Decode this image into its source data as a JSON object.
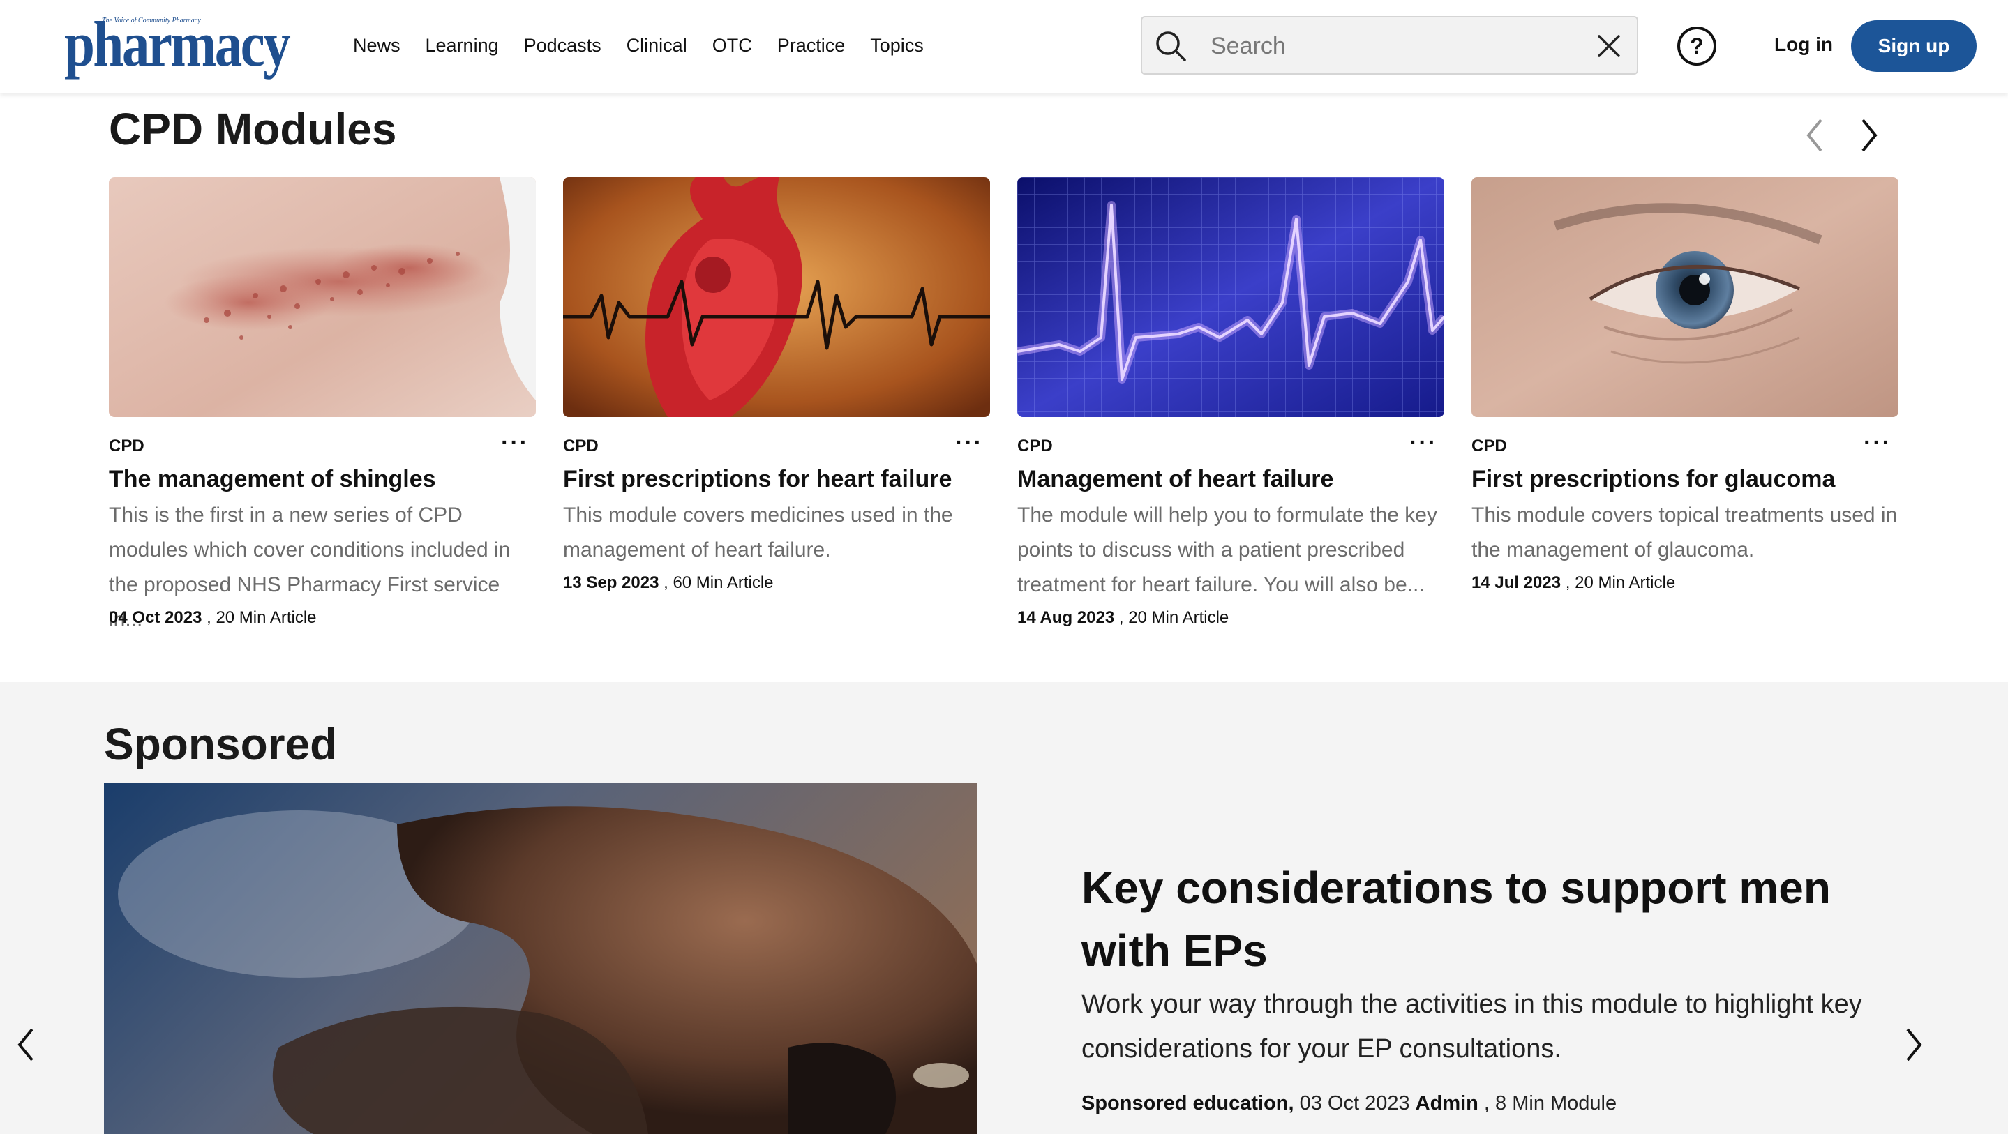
{
  "brand": {
    "logo_word": "pharmacy",
    "logo_tagline": "The Voice of Community Pharmacy",
    "color": "#1f4f8f"
  },
  "nav": [
    "News",
    "Learning",
    "Podcasts",
    "Clinical",
    "OTC",
    "Practice",
    "Topics"
  ],
  "search": {
    "placeholder": "Search",
    "value": ""
  },
  "header_actions": {
    "help_icon": "question-circle-icon",
    "login": "Log in",
    "signup": "Sign up",
    "signup_color": "#1c5598"
  },
  "cpd": {
    "heading": "CPD Modules",
    "cards": [
      {
        "label": "CPD",
        "title": "The management of shingles",
        "description": "This is the first in a new series of CPD modules which cover conditions included in the proposed NHS Pharmacy First service in...",
        "date": "04 Oct 2023",
        "meta": " , 20 Min Article",
        "image": "shingles-rash-skin"
      },
      {
        "label": "CPD",
        "title": "First prescriptions for heart failure",
        "description": "This module covers medicines used in the management of heart failure.",
        "date": "13 Sep 2023",
        "meta": " , 60 Min Article",
        "image": "heart-ecg-illustration"
      },
      {
        "label": "CPD",
        "title": "Management of heart failure",
        "description": "The module will help you to formulate the key points to discuss with a patient prescribed treatment for heart failure. You will also be...",
        "date": "14 Aug 2023",
        "meta": " , 20 Min Article",
        "image": "ecg-monitor-screen"
      },
      {
        "label": "CPD",
        "title": "First prescriptions for glaucoma",
        "description": "This module covers topical treatments used in the management of glaucoma.",
        "date": "14 Jul 2023",
        "meta": " , 20 Min Article",
        "image": "elderly-eye-closeup"
      }
    ]
  },
  "sponsored": {
    "heading": "Sponsored",
    "headline": "Key considerations to support men with EPs",
    "description": "Work your way through the activities in this module to highlight key considerations for your EP consultations.",
    "category": "Sponsored education,",
    "date": " 03 Oct 2023 ",
    "author": "Admin",
    "meta": " , 8 Min Module",
    "image": "couple-in-bed-photo"
  }
}
